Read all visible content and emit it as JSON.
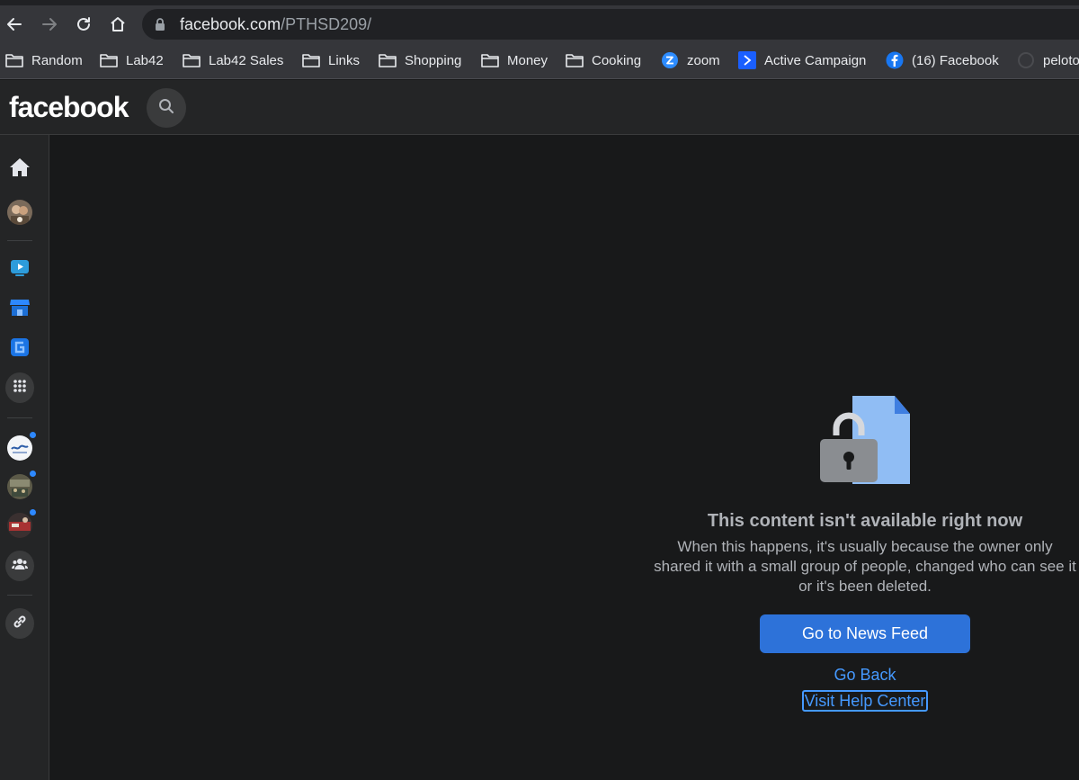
{
  "browser": {
    "url_host": "facebook.com",
    "url_path": "/PTHSD209/",
    "bookmarks": [
      {
        "label": "Random",
        "icon": "folder-icon"
      },
      {
        "label": "Lab42",
        "icon": "folder-icon"
      },
      {
        "label": "Lab42 Sales",
        "icon": "folder-icon"
      },
      {
        "label": "Links",
        "icon": "folder-icon"
      },
      {
        "label": "Shopping",
        "icon": "folder-icon"
      },
      {
        "label": "Money",
        "icon": "folder-icon"
      },
      {
        "label": "Cooking",
        "icon": "folder-icon"
      },
      {
        "label": "zoom",
        "icon": "zoom-icon"
      },
      {
        "label": "Active Campaign",
        "icon": "active-campaign-icon"
      },
      {
        "label": "(16) Facebook",
        "icon": "facebook-icon"
      },
      {
        "label": "peloto",
        "icon": "peloton-icon"
      }
    ]
  },
  "header": {
    "logo": "facebook"
  },
  "notice": {
    "title": "This content isn't available right now",
    "body": "When this happens, it's usually because the owner only shared it with a small group of people, changed who can see it or it's been deleted.",
    "primary_button": "Go to News Feed",
    "back_link": "Go Back",
    "help_link": "Visit Help Center"
  },
  "colors": {
    "accent": "#2d72d9",
    "link": "#4599ff",
    "notification_dot": "#2d88ff"
  }
}
